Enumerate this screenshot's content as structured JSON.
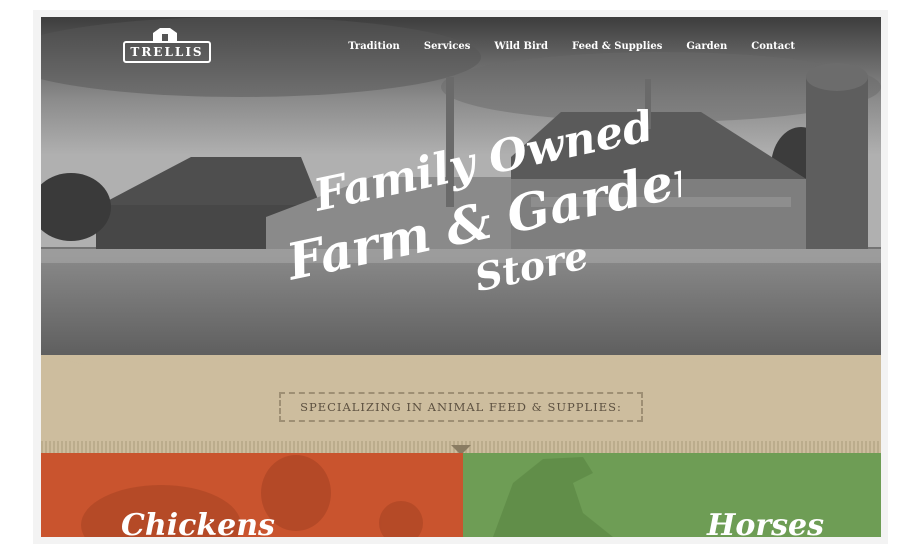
{
  "brand": {
    "logo_text": "TRELLIS"
  },
  "nav": {
    "items": [
      {
        "label": "Tradition"
      },
      {
        "label": "Services"
      },
      {
        "label": "Wild Bird"
      },
      {
        "label": "Feed & Supplies"
      },
      {
        "label": "Garden"
      },
      {
        "label": "Contact"
      }
    ]
  },
  "hero": {
    "line1": "Family Owned",
    "line2": "Farm & Garden",
    "line3": "Store"
  },
  "specializing": {
    "text": "SPECIALIZING IN ANIMAL FEED & SUPPLIES:"
  },
  "categories": [
    {
      "label": "Chickens",
      "color": "#c9542e"
    },
    {
      "label": "Horses",
      "color": "#6e9d55"
    }
  ]
}
